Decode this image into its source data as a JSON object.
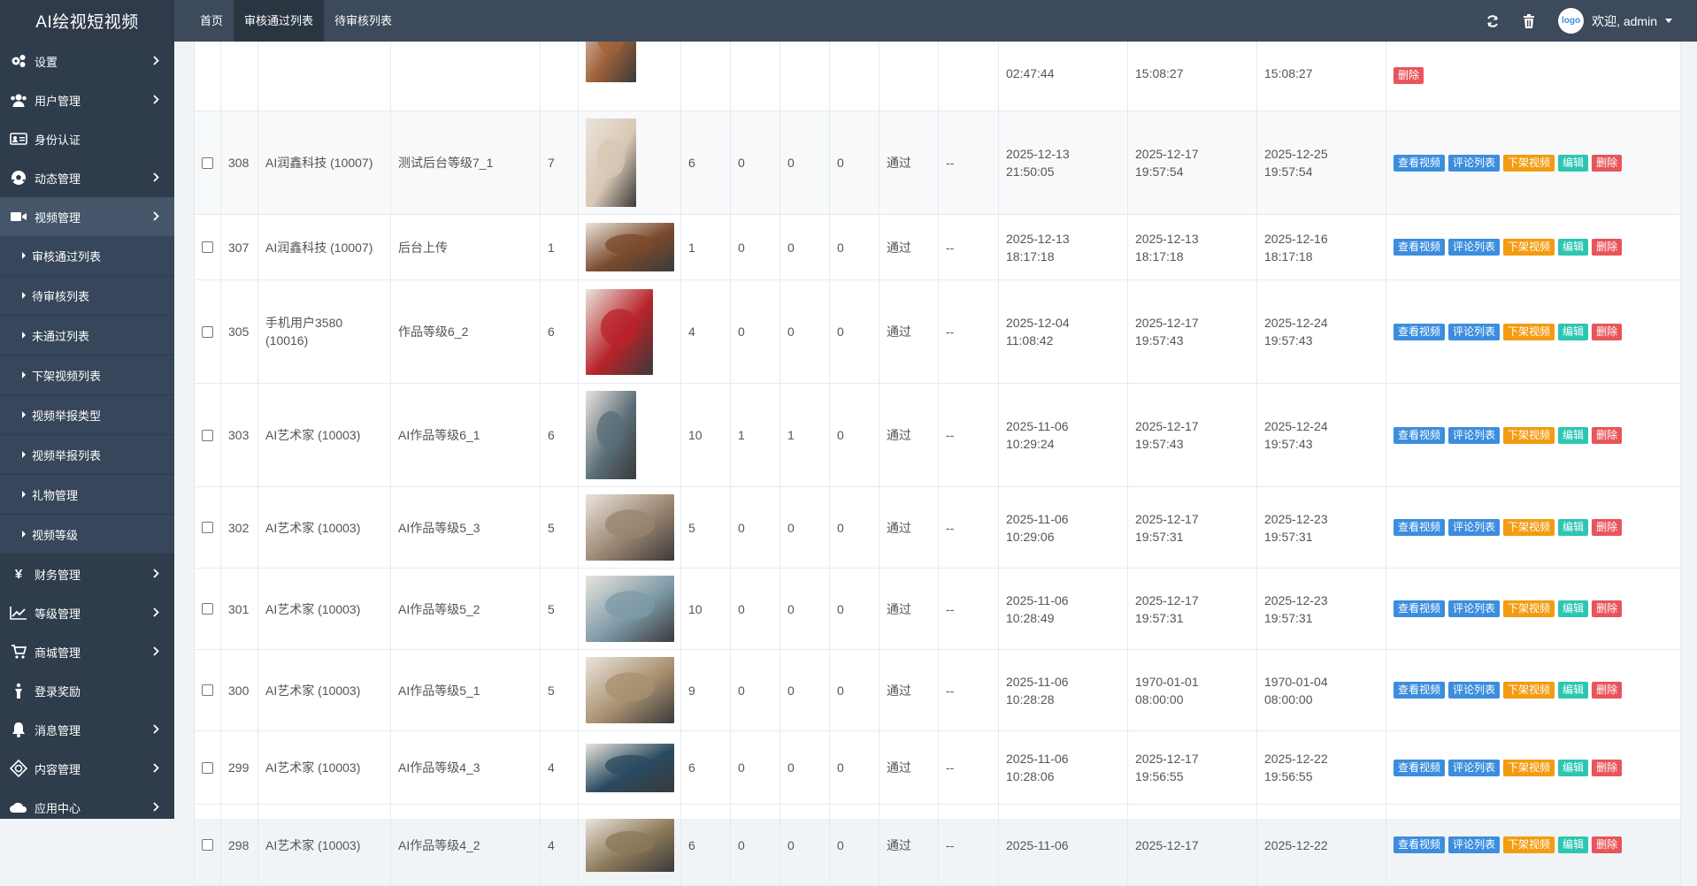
{
  "brand": "AI绘视短视频",
  "nav": {
    "home": "首页",
    "approved": "审核通过列表",
    "pending": "待审核列表"
  },
  "header": {
    "user": "欢迎, admin",
    "avatar_text": "logo"
  },
  "sidebar": {
    "items": [
      {
        "label": "设置",
        "icon": "gear-icon"
      },
      {
        "label": "用户管理",
        "icon": "users-icon"
      },
      {
        "label": "身份认证",
        "icon": "id-card-icon"
      },
      {
        "label": "动态管理",
        "icon": "soccer-ball-icon"
      },
      {
        "label": "视频管理",
        "icon": "video-camera-icon"
      }
    ],
    "sub_items": [
      "审核通过列表",
      "待审核列表",
      "未通过列表",
      "下架视频列表",
      "视频举报类型",
      "视频举报列表",
      "礼物管理",
      "视频等级"
    ],
    "items_after": [
      {
        "label": "财务管理",
        "icon": "yen-icon"
      },
      {
        "label": "等级管理",
        "icon": "line-chart-icon"
      },
      {
        "label": "商城管理",
        "icon": "cart-icon"
      },
      {
        "label": "登录奖励",
        "icon": "gift-icon"
      },
      {
        "label": "消息管理",
        "icon": "bell-icon"
      },
      {
        "label": "内容管理",
        "icon": "content-icon"
      },
      {
        "label": "应用中心",
        "icon": "cloud-icon"
      }
    ]
  },
  "buttons": {
    "view": "查看视频",
    "comments": "评论列表",
    "takedown": "下架视频",
    "edit": "编辑",
    "delete": "删除"
  },
  "rows": [
    {
      "id": "",
      "user": "",
      "title": "",
      "level": "",
      "c1": "",
      "c2": "",
      "c3": "",
      "c4": "",
      "status": "",
      "remark": "",
      "t1": "02:47:44",
      "t2": "15:08:27",
      "t3": "15:08:27",
      "thumb_color": "#a0623a"
    },
    {
      "id": "308",
      "user": "AI润鑫科技 (10007)",
      "title": "测试后台等级7_1",
      "level": "7",
      "c1": "6",
      "c2": "0",
      "c3": "0",
      "c4": "0",
      "status": "通过",
      "remark": "--",
      "t1": "2025-12-13 21:50:05",
      "t2": "2025-12-17 19:57:54",
      "t3": "2025-12-25 19:57:54",
      "thumb_color": "#d8c7b4"
    },
    {
      "id": "307",
      "user": "AI润鑫科技 (10007)",
      "title": "后台上传",
      "level": "1",
      "c1": "1",
      "c2": "0",
      "c3": "0",
      "c4": "0",
      "status": "通过",
      "remark": "--",
      "t1": "2025-12-13 18:17:18",
      "t2": "2025-12-13 18:17:18",
      "t3": "2025-12-16 18:17:18",
      "thumb_color": "#7a4a2c"
    },
    {
      "id": "305",
      "user": "手机用户3580 (10016)",
      "title": "作品等级6_2",
      "level": "6",
      "c1": "4",
      "c2": "0",
      "c3": "0",
      "c4": "0",
      "status": "通过",
      "remark": "--",
      "t1": "2025-12-04 11:08:42",
      "t2": "2025-12-17 19:57:43",
      "t3": "2025-12-24 19:57:43",
      "thumb_color": "#b8232a"
    },
    {
      "id": "303",
      "user": "AI艺术家 (10003)",
      "title": "AI作品等级6_1",
      "level": "6",
      "c1": "10",
      "c2": "1",
      "c3": "1",
      "c4": "0",
      "status": "通过",
      "remark": "--",
      "t1": "2025-11-06 10:29:24",
      "t2": "2025-12-17 19:57:43",
      "t3": "2025-12-24 19:57:43",
      "thumb_color": "#5a6e78"
    },
    {
      "id": "302",
      "user": "AI艺术家 (10003)",
      "title": "AI作品等级5_3",
      "level": "5",
      "c1": "5",
      "c2": "0",
      "c3": "0",
      "c4": "0",
      "status": "通过",
      "remark": "--",
      "t1": "2025-11-06 10:29:06",
      "t2": "2025-12-17 19:57:31",
      "t3": "2025-12-23 19:57:31",
      "thumb_color": "#9a8470"
    },
    {
      "id": "301",
      "user": "AI艺术家 (10003)",
      "title": "AI作品等级5_2",
      "level": "5",
      "c1": "10",
      "c2": "0",
      "c3": "0",
      "c4": "0",
      "status": "通过",
      "remark": "--",
      "t1": "2025-11-06 10:28:49",
      "t2": "2025-12-17 19:57:31",
      "t3": "2025-12-23 19:57:31",
      "thumb_color": "#7d9aa8"
    },
    {
      "id": "300",
      "user": "AI艺术家 (10003)",
      "title": "AI作品等级5_1",
      "level": "5",
      "c1": "9",
      "c2": "0",
      "c3": "0",
      "c4": "0",
      "status": "通过",
      "remark": "--",
      "t1": "2025-11-06 10:28:28",
      "t2": "1970-01-01 08:00:00",
      "t3": "1970-01-04 08:00:00",
      "thumb_color": "#a89070"
    },
    {
      "id": "299",
      "user": "AI艺术家 (10003)",
      "title": "AI作品等级4_3",
      "level": "4",
      "c1": "6",
      "c2": "0",
      "c3": "0",
      "c4": "0",
      "status": "通过",
      "remark": "--",
      "t1": "2025-11-06 10:28:06",
      "t2": "2025-12-17 19:56:55",
      "t3": "2025-12-22 19:56:55",
      "thumb_color": "#2a4a60"
    },
    {
      "id": "298",
      "user": "AI艺术家 (10003)",
      "title": "AI作品等级4_2",
      "level": "4",
      "c1": "6",
      "c2": "0",
      "c3": "0",
      "c4": "0",
      "status": "通过",
      "remark": "--",
      "t1": "2025-11-06",
      "t2": "2025-12-17",
      "t3": "2025-12-22",
      "thumb_color": "#8a7858"
    }
  ]
}
